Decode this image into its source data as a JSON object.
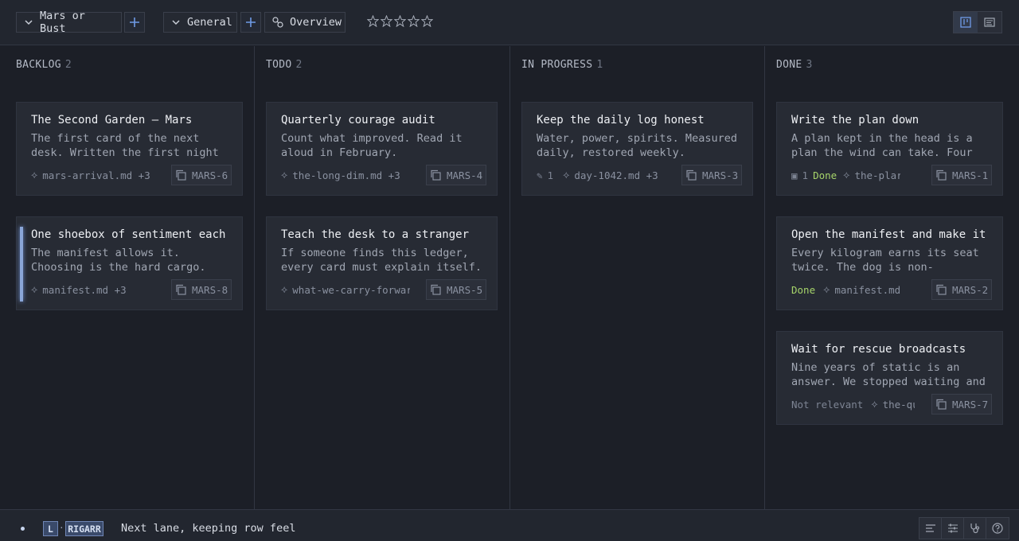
{
  "toolbar": {
    "project": "Mars or Bust",
    "board": "General",
    "view": "Overview",
    "rating": 0,
    "rating_max": 5
  },
  "lanes": [
    {
      "name": "BACKLOG",
      "count": "2"
    },
    {
      "name": "TODO",
      "count": "2"
    },
    {
      "name": "IN PROGRESS",
      "count": "1"
    },
    {
      "name": "DONE",
      "count": "3"
    }
  ],
  "cards": {
    "backlog_1": {
      "title": "The Second Garden — Mars",
      "desc": "The first card of the next\ndesk. Written the first night",
      "link": "mars-arrival.md +3",
      "id": "MARS-6"
    },
    "backlog_2": {
      "title": "One shoebox of sentiment each",
      "desc": "The manifest allows it.\nChoosing is the hard cargo.",
      "link": "manifest.md +3",
      "id": "MARS-8"
    },
    "todo_1": {
      "title": "Quarterly courage audit",
      "desc": "Count what improved. Read it\naloud in February.",
      "link": "the-long-dim.md +3",
      "id": "MARS-4"
    },
    "todo_2": {
      "title": "Teach the desk to a stranger",
      "desc": "If someone finds this ledger,\nevery card must explain itself.",
      "link": "what-we-carry-forwar",
      "id": "MARS-5"
    },
    "progress_1": {
      "title": "Keep the daily log honest",
      "desc": "Water, power, spirits. Measured\ndaily, restored weekly.",
      "edits": "1",
      "link": "day-1042.md +3",
      "id": "MARS-3"
    },
    "done_1": {
      "title": "Write the plan down",
      "desc": "A plan kept in the head is a\nplan the wind can take. Four",
      "checks": "1",
      "status": "Done",
      "link": "the-plar",
      "id": "MARS-1"
    },
    "done_2": {
      "title": "Open the manifest and make it",
      "desc": "Every kilogram earns its seat\ntwice. The dog is non-",
      "status": "Done",
      "link": "manifest.md",
      "id": "MARS-2"
    },
    "done_3": {
      "title": "Wait for rescue broadcasts",
      "desc": "Nine years of static is an\nanswer. We stopped waiting and",
      "status": "Not relevant",
      "link": "the-qu",
      "id": "MARS-7"
    }
  },
  "statusbar": {
    "key_1": "L",
    "key_sep": "·",
    "key_2": "RIGARR",
    "message": "Next lane, keeping row feel"
  },
  "colors": {
    "background": "#1c1f27",
    "card": "#272b34",
    "accent": "#6f9be6",
    "done": "#a6d46a"
  }
}
